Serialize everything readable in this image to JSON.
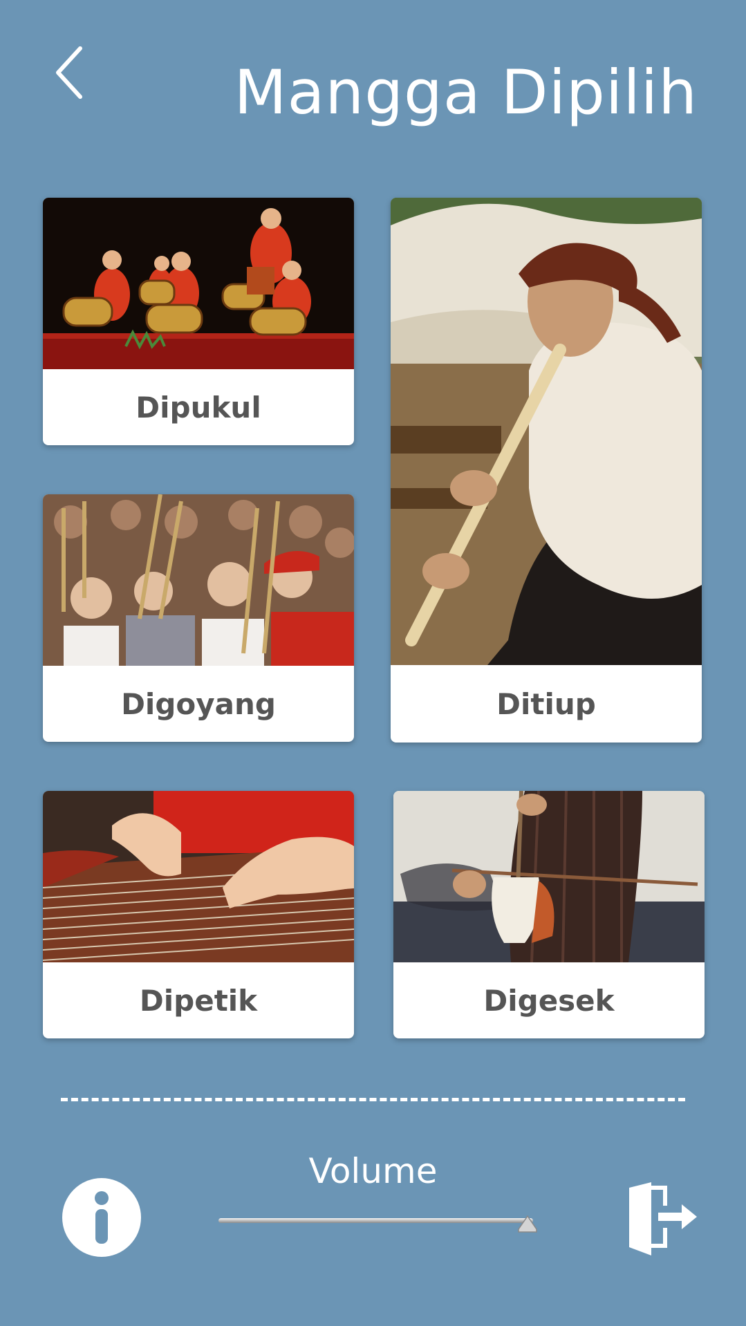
{
  "header": {
    "title": "Mangga Dipilih",
    "back_icon": "chevron-left-icon"
  },
  "cards": [
    {
      "label": "Dipukul",
      "image": "gamelan-drummers-photo"
    },
    {
      "label": "Ditiup",
      "image": "suling-flute-player-photo"
    },
    {
      "label": "Digoyang",
      "image": "angklung-crowd-photo"
    },
    {
      "label": "Dipetik",
      "image": "kecapi-zither-hands-photo"
    },
    {
      "label": "Digesek",
      "image": "rebab-player-photo"
    }
  ],
  "footer": {
    "volume_label": "Volume",
    "volume_level": 1.0,
    "info_icon": "info-icon",
    "exit_icon": "exit-door-icon"
  },
  "colors": {
    "background": "#6b95b5",
    "card": "#ffffff",
    "label_text": "#555555"
  }
}
